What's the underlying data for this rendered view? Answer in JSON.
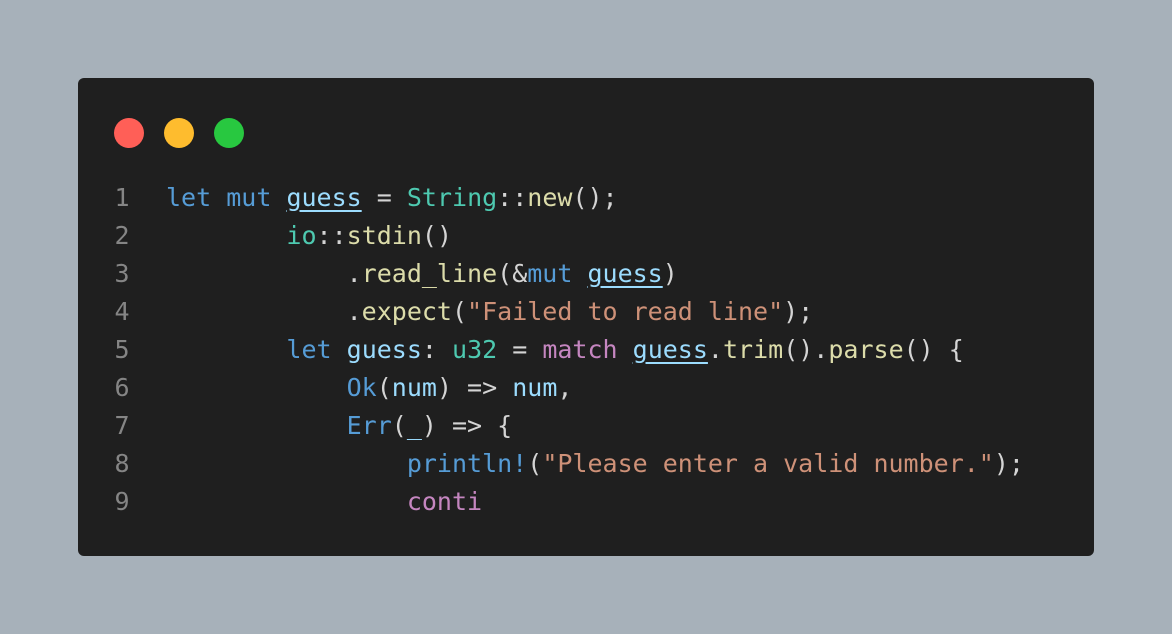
{
  "window": {
    "buttons": [
      "close",
      "minimize",
      "maximize"
    ],
    "colors": {
      "close": "#ff5f57",
      "minimize": "#febc2e",
      "maximize": "#28c840"
    }
  },
  "editor": {
    "theme": "dark",
    "lines": [
      {
        "number": "1",
        "tokens": [
          {
            "t": "let",
            "c": "kw"
          },
          {
            "t": " ",
            "c": "p"
          },
          {
            "t": "mut",
            "c": "kw"
          },
          {
            "t": " ",
            "c": "p"
          },
          {
            "t": "guess",
            "c": "var und"
          },
          {
            "t": " = ",
            "c": "p"
          },
          {
            "t": "String",
            "c": "ty"
          },
          {
            "t": "::",
            "c": "p"
          },
          {
            "t": "new",
            "c": "fn"
          },
          {
            "t": "();",
            "c": "p"
          }
        ]
      },
      {
        "number": "2",
        "tokens": [
          {
            "t": "        ",
            "c": "p"
          },
          {
            "t": "io",
            "c": "ty"
          },
          {
            "t": "::",
            "c": "p"
          },
          {
            "t": "stdin",
            "c": "fn"
          },
          {
            "t": "()",
            "c": "p"
          }
        ]
      },
      {
        "number": "3",
        "tokens": [
          {
            "t": "            .",
            "c": "p"
          },
          {
            "t": "read_line",
            "c": "fn"
          },
          {
            "t": "(&",
            "c": "p"
          },
          {
            "t": "mut",
            "c": "kw"
          },
          {
            "t": " ",
            "c": "p"
          },
          {
            "t": "guess",
            "c": "var und"
          },
          {
            "t": ")",
            "c": "p"
          }
        ]
      },
      {
        "number": "4",
        "tokens": [
          {
            "t": "            .",
            "c": "p"
          },
          {
            "t": "expect",
            "c": "fn"
          },
          {
            "t": "(",
            "c": "p"
          },
          {
            "t": "\"Failed to read line\"",
            "c": "str"
          },
          {
            "t": ");",
            "c": "p"
          }
        ]
      },
      {
        "number": "5",
        "tokens": [
          {
            "t": "        ",
            "c": "p"
          },
          {
            "t": "let",
            "c": "kw"
          },
          {
            "t": " ",
            "c": "p"
          },
          {
            "t": "guess",
            "c": "var"
          },
          {
            "t": ": ",
            "c": "p"
          },
          {
            "t": "u32",
            "c": "ty"
          },
          {
            "t": " = ",
            "c": "p"
          },
          {
            "t": "match",
            "c": "ctl"
          },
          {
            "t": " ",
            "c": "p"
          },
          {
            "t": "guess",
            "c": "var und"
          },
          {
            "t": ".",
            "c": "p"
          },
          {
            "t": "trim",
            "c": "fn"
          },
          {
            "t": "().",
            "c": "p"
          },
          {
            "t": "parse",
            "c": "fn"
          },
          {
            "t": "() {",
            "c": "p"
          }
        ]
      },
      {
        "number": "6",
        "tokens": [
          {
            "t": "            ",
            "c": "p"
          },
          {
            "t": "Ok",
            "c": "kw"
          },
          {
            "t": "(",
            "c": "p"
          },
          {
            "t": "num",
            "c": "var"
          },
          {
            "t": ") => ",
            "c": "p"
          },
          {
            "t": "num",
            "c": "var"
          },
          {
            "t": ",",
            "c": "p"
          }
        ]
      },
      {
        "number": "7",
        "tokens": [
          {
            "t": "            ",
            "c": "p"
          },
          {
            "t": "Err",
            "c": "kw"
          },
          {
            "t": "(",
            "c": "p"
          },
          {
            "t": "_",
            "c": "var"
          },
          {
            "t": ") => {",
            "c": "p"
          }
        ]
      },
      {
        "number": "8",
        "tokens": [
          {
            "t": "                ",
            "c": "p"
          },
          {
            "t": "println!",
            "c": "kw"
          },
          {
            "t": "(",
            "c": "p"
          },
          {
            "t": "\"Please enter a valid number.\"",
            "c": "str"
          },
          {
            "t": ");",
            "c": "p"
          }
        ]
      },
      {
        "number": "9",
        "tokens": [
          {
            "t": "                ",
            "c": "p"
          },
          {
            "t": "conti",
            "c": "ctl"
          }
        ]
      }
    ]
  }
}
